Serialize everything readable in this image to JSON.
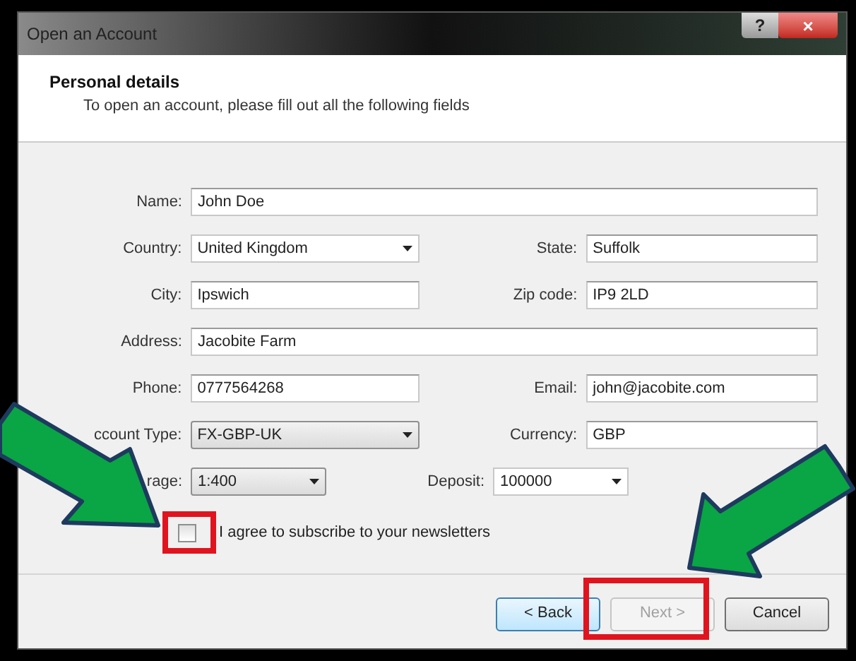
{
  "window": {
    "title": "Open an Account",
    "title_buttons": [
      {
        "kind": "help",
        "label": "?"
      },
      {
        "kind": "close",
        "label": "×"
      }
    ]
  },
  "header": {
    "title": "Personal details",
    "subtitle": "To open an account, please fill out all the following fields"
  },
  "rows": [
    {
      "fields": [
        {
          "label": "Name:",
          "kind": "text",
          "value": "John Doe"
        }
      ]
    },
    {
      "fields": [
        {
          "label": "Country:",
          "kind": "combo",
          "value": "United Kingdom"
        },
        {
          "label": "State:",
          "kind": "text",
          "value": "Suffolk"
        }
      ]
    },
    {
      "fields": [
        {
          "label": "City:",
          "kind": "text",
          "value": "Ipswich"
        },
        {
          "label": "Zip code:",
          "kind": "text",
          "value": "IP9 2LD"
        }
      ]
    },
    {
      "fields": [
        {
          "label": "Address:",
          "kind": "text",
          "value": "Jacobite Farm"
        }
      ]
    },
    {
      "fields": [
        {
          "label": "Phone:",
          "kind": "text",
          "value": "0777564268"
        },
        {
          "label": "Email:",
          "kind": "text",
          "value": "john@jacobite.com"
        }
      ]
    },
    {
      "fields": [
        {
          "label": "ccount Type:",
          "kind": "dropdown",
          "value": "FX-GBP-UK"
        },
        {
          "label": "Currency:",
          "kind": "text",
          "value": "GBP"
        }
      ]
    },
    {
      "fields": [
        {
          "label": "rage:",
          "kind": "dropdown",
          "value": "1:400"
        },
        {
          "label": "Deposit:",
          "kind": "combo",
          "value": "100000"
        }
      ]
    }
  ],
  "newsletter": {
    "label": "I agree to subscribe to your newsletters",
    "checked": false
  },
  "buttons": [
    {
      "label": "< Back",
      "disabled": false,
      "selected": true
    },
    {
      "label": "Next >",
      "disabled": true,
      "selected": false
    },
    {
      "label": "Cancel",
      "disabled": false,
      "selected": false
    }
  ]
}
